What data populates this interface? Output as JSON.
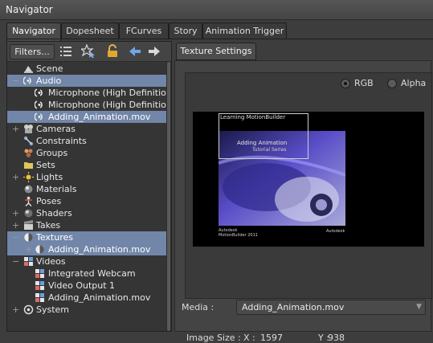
{
  "window": {
    "title": "Navigator"
  },
  "tabs": [
    {
      "label": "Navigator",
      "active": true
    },
    {
      "label": "Dopesheet",
      "active": false
    },
    {
      "label": "FCurves",
      "active": false
    },
    {
      "label": "Story",
      "active": false
    },
    {
      "label": "Animation Trigger",
      "active": false
    }
  ],
  "toolbar": {
    "filters_label": "Filters...",
    "icons": [
      "list-view-icon",
      "star-select-icon",
      "lock-icon",
      "back-arrow-icon",
      "forward-arrow-icon"
    ]
  },
  "tree": [
    {
      "label": "Scene",
      "depth": 0,
      "expander": "",
      "icon": "scene-icon"
    },
    {
      "label": "Audio",
      "depth": 0,
      "expander": "−",
      "icon": "audio-icon",
      "selected": true
    },
    {
      "label": "Microphone (High Definition Au",
      "depth": 1,
      "expander": "",
      "icon": "audio-icon"
    },
    {
      "label": "Microphone (High Definition Au",
      "depth": 1,
      "expander": "",
      "icon": "audio-icon"
    },
    {
      "label": "Adding_Animation.mov",
      "depth": 1,
      "expander": "",
      "icon": "audio-icon",
      "selected": true
    },
    {
      "label": "Cameras",
      "depth": 0,
      "expander": "+",
      "icon": "camera-icon"
    },
    {
      "label": "Constraints",
      "depth": 0,
      "expander": "",
      "icon": "constraint-icon"
    },
    {
      "label": "Groups",
      "depth": 0,
      "expander": "",
      "icon": "group-icon"
    },
    {
      "label": "Sets",
      "depth": 0,
      "expander": "",
      "icon": "folder-icon"
    },
    {
      "label": "Lights",
      "depth": 0,
      "expander": "+",
      "icon": "light-icon"
    },
    {
      "label": "Materials",
      "depth": 0,
      "expander": "",
      "icon": "material-icon"
    },
    {
      "label": "Poses",
      "depth": 0,
      "expander": "",
      "icon": "pose-icon"
    },
    {
      "label": "Shaders",
      "depth": 0,
      "expander": "+",
      "icon": "shader-icon"
    },
    {
      "label": "Takes",
      "depth": 0,
      "expander": "+",
      "icon": "take-icon"
    },
    {
      "label": "Textures",
      "depth": 0,
      "expander": "−",
      "icon": "texture-icon",
      "selected": true
    },
    {
      "label": "Adding_Animation.mov",
      "depth": 1,
      "expander": "+",
      "icon": "texture-icon",
      "selected": true
    },
    {
      "label": "Videos",
      "depth": 0,
      "expander": "−",
      "icon": "video-icon"
    },
    {
      "label": "Integrated Webcam",
      "depth": 1,
      "expander": "",
      "icon": "video-icon"
    },
    {
      "label": "Video Output 1",
      "depth": 1,
      "expander": "",
      "icon": "video-icon"
    },
    {
      "label": "Adding_Animation.mov",
      "depth": 1,
      "expander": "",
      "icon": "video-icon"
    },
    {
      "label": "System",
      "depth": 0,
      "expander": "+",
      "icon": "system-icon"
    }
  ],
  "right": {
    "tab_label": "Texture Settings",
    "rgb_label": "RGB",
    "alpha_label": "Alpha",
    "selected_channel": "RGB",
    "preview": {
      "title_text": "Learning MotionBuilder",
      "heading_text": "Adding Animation",
      "sub_text": "Tutorial Series",
      "footer_left_1": "Autodesk",
      "footer_left_2": "MotionBuilder 2011",
      "footer_right": "Autodesk"
    },
    "media_label": "Media :",
    "media_value": "Adding_Animation.mov",
    "image_size_label": "Image Size :",
    "x_label": "X :",
    "x_value": "1597",
    "y_label": "Y :",
    "y_value": "938"
  },
  "colors": {
    "selection": "#7186a8",
    "background": "#3d3d3d"
  }
}
